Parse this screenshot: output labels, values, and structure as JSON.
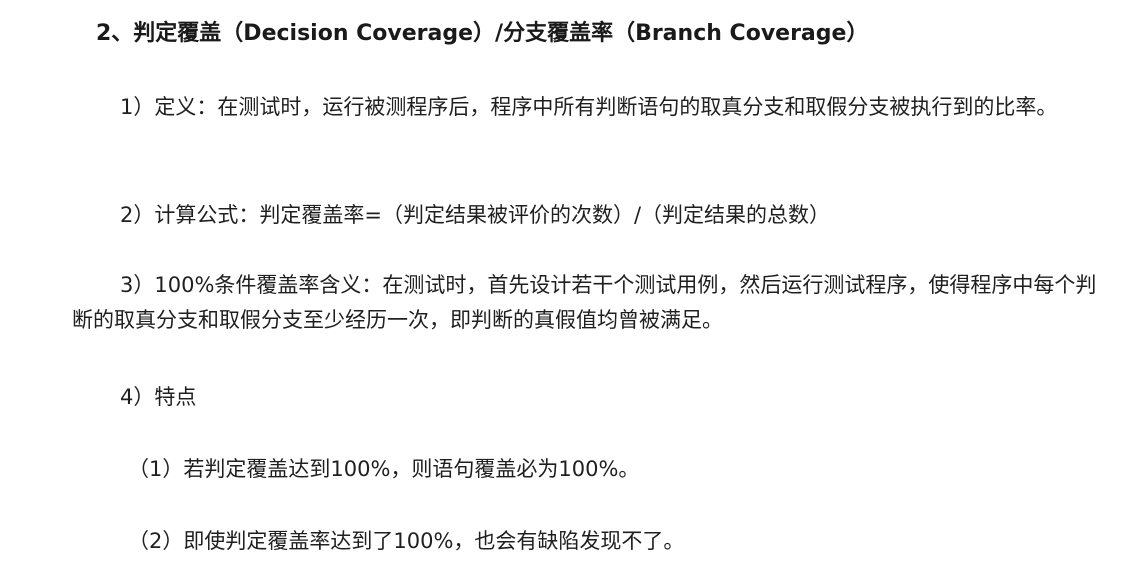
{
  "section": {
    "heading": "2、判定覆盖（Decision Coverage）/分支覆盖率（Branch Coverage）"
  },
  "paragraphs": [
    "1）定义：在测试时，运行被测程序后，程序中所有判断语句的取真分支和取假分支被执行到的比率。",
    "2）计算公式：判定覆盖率=（判定结果被评价的次数）/（判定结果的总数）",
    "3）100%条件覆盖率含义：在测试时，首先设计若干个测试用例，然后运行测试程序，使得程序中每个判断的取真分支和取假分支至少经历一次，即判断的真假值均曾被满足。",
    "4）特点",
    "（1）若判定覆盖达到100%，则语句覆盖必为100%。",
    "（2）即使判定覆盖率达到了100%，也会有缺陷发现不了。"
  ]
}
